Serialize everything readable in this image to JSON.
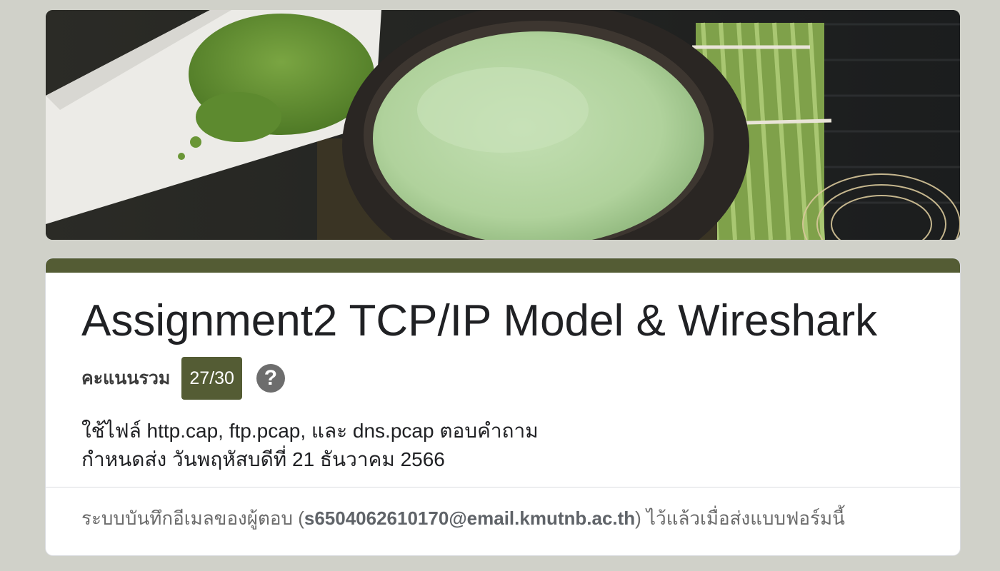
{
  "banner": {
    "image": "matcha-tea-bowl-banner",
    "colors": {
      "matcha": "#b9d8a8",
      "powder": "#6f9a3a",
      "bamboo": "#8fb35a",
      "bowl": "#2a2623"
    }
  },
  "form": {
    "title": "Assignment2 TCP/IP Model & Wireshark",
    "score_label": "คะแนนรวม",
    "score_value": "27/30",
    "help_icon": "help-circle-icon",
    "description_lines": [
      "ใช้ไฟล์ http.cap, ftp.pcap, และ dns.pcap ตอบคำถาม",
      "กำหนดส่ง วันพฤหัสบดีที่ 21 ธันวาคม 2566"
    ],
    "email_note_prefix": "ระบบบันทึกอีเมลของผู้ตอบ (",
    "email": "s6504062610170@email.kmutnb.ac.th",
    "email_note_suffix": ") ไว้แล้วเมื่อส่งแบบฟอร์มนี้"
  },
  "theme": {
    "accent": "#545c34",
    "page_background": "#d0d1c9"
  }
}
